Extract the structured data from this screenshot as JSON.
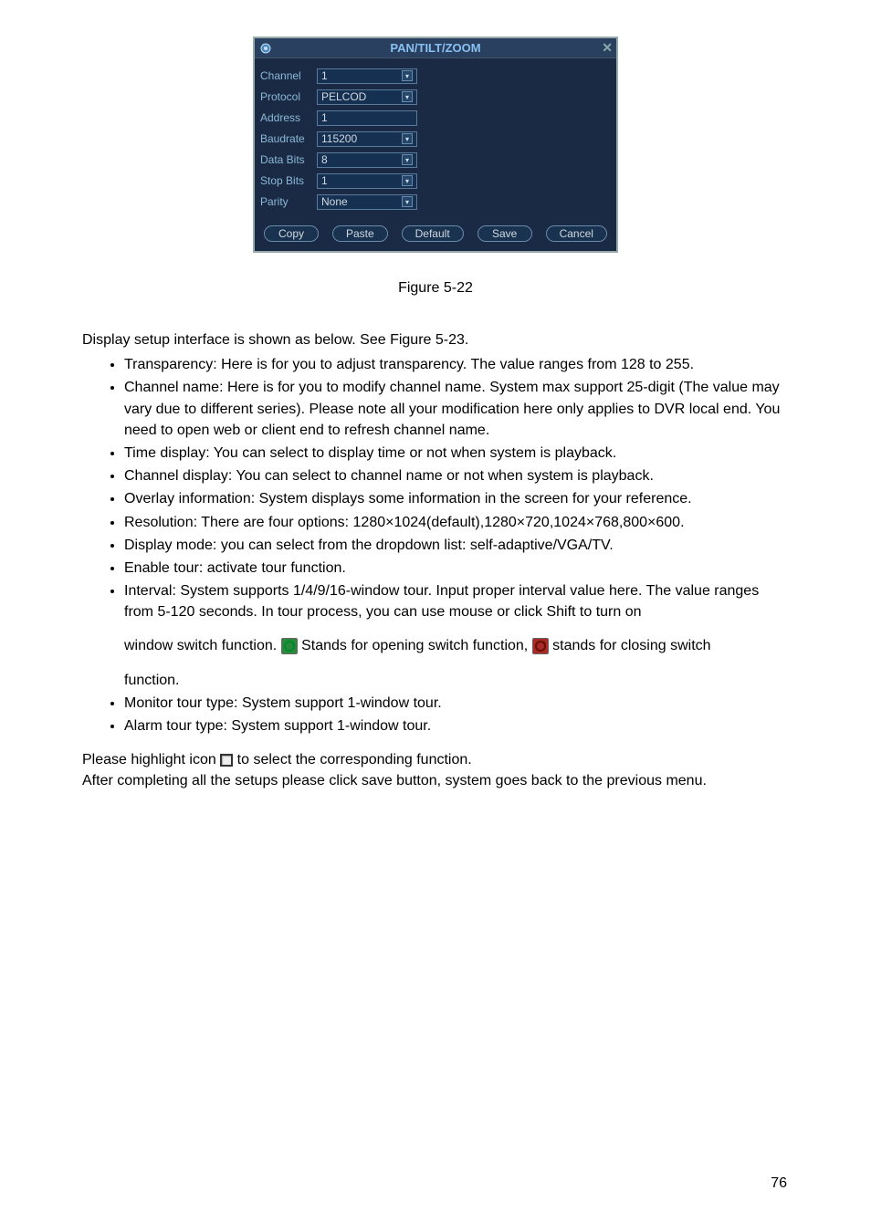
{
  "dialog": {
    "title": "PAN/TILT/ZOOM",
    "rows": {
      "channel": {
        "label": "Channel",
        "value": "1"
      },
      "protocol": {
        "label": "Protocol",
        "value": "PELCOD"
      },
      "address": {
        "label": "Address",
        "value": "1"
      },
      "baudrate": {
        "label": "Baudrate",
        "value": "115200"
      },
      "databits": {
        "label": "Data Bits",
        "value": "8"
      },
      "stopbits": {
        "label": "Stop Bits",
        "value": "1"
      },
      "parity": {
        "label": "Parity",
        "value": "None"
      }
    },
    "buttons": {
      "copy": "Copy",
      "paste": "Paste",
      "default": "Default",
      "save": "Save",
      "cancel": "Cancel"
    }
  },
  "figcap": "Figure 5-22",
  "intro": "Display setup interface is shown as below. See Figure 5-23.",
  "bullets": {
    "b1": "Transparency: Here is for you to adjust transparency. The value ranges from 128 to 255.",
    "b2": "Channel name: Here is for you to modify channel name. System max support 25-digit (The value may vary due to different series). Please note all your modification here only applies to DVR local end. You need to open web or client end to refresh channel name.",
    "b3": "Time display: You can select to display time or not when system is playback.",
    "b4": "Channel display: You can select to channel name or not when system is playback.",
    "b5": "Overlay information: System displays some information in the screen for your reference.",
    "b6": "Resolution: There are four options: 1280×1024(default),1280×720,1024×768,800×600.",
    "b7": "Display mode: you can select from the dropdown list: self-adaptive/VGA/TV.",
    "b8": "Enable tour: activate tour function.",
    "b9a": "Interval: System supports 1/4/9/16-window tour. Input proper interval value here. The value ranges from 5-120 seconds. In tour process, you can use mouse or click Shift to turn on",
    "b9b_pre": "window switch function. ",
    "b9b_mid": " Stands for opening switch function, ",
    "b9b_post": " stands for closing switch",
    "b9c": "function.",
    "b10": "Monitor tour type: System support 1-window tour.",
    "b11": "Alarm tour type: System support 1-window tour."
  },
  "post1_pre": "Please highlight icon  ",
  "post1_post": " to select the corresponding function.",
  "post2": "After completing all the setups please click save button, system goes back to the previous menu.",
  "pagenum": "76"
}
